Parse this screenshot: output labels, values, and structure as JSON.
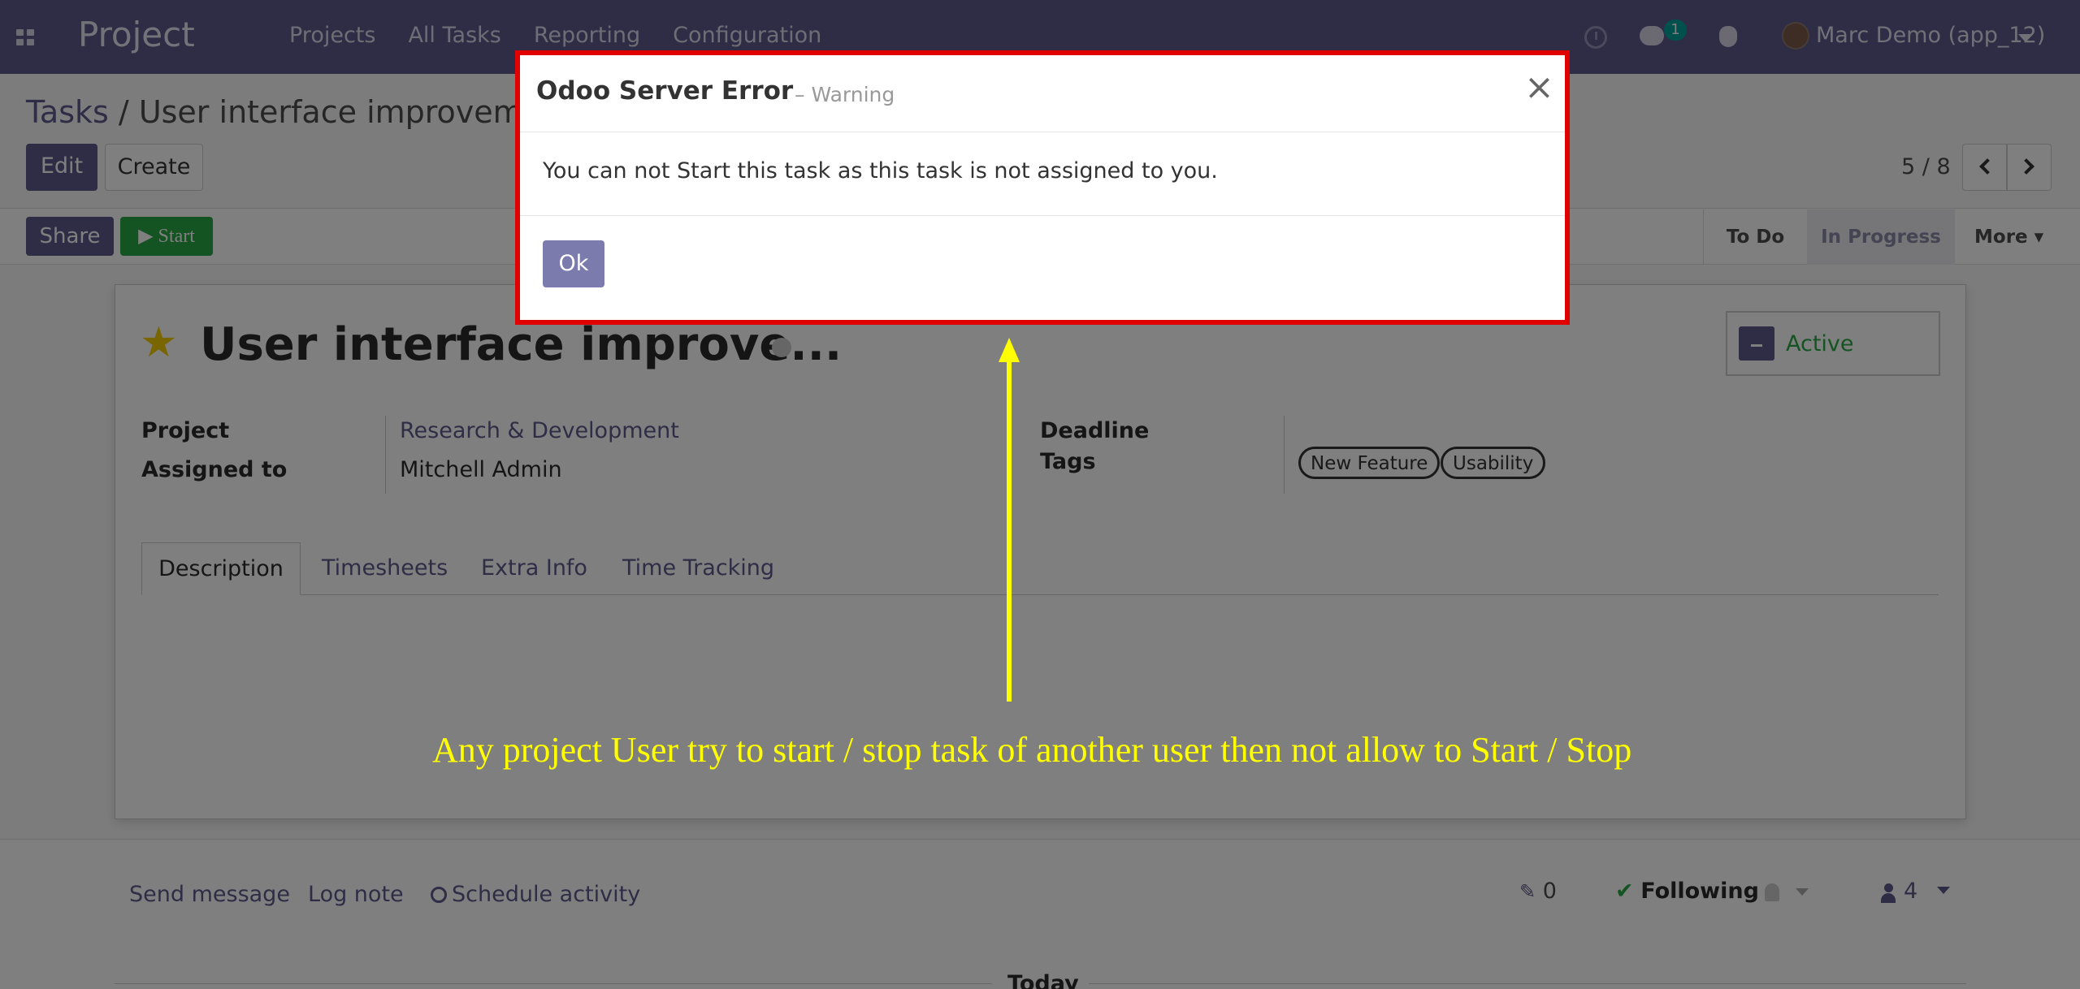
{
  "navbar": {
    "brand": "Project",
    "menu": [
      "Projects",
      "All Tasks",
      "Reporting",
      "Configuration"
    ],
    "chat_badge": "1",
    "user_name": "Marc Demo (app_12)"
  },
  "breadcrumb": {
    "parent": "Tasks",
    "separator": "/",
    "current": "User interface improvemer"
  },
  "toolbar": {
    "edit_label": "Edit",
    "create_label": "Create",
    "pager": "5 / 8"
  },
  "statusbar": {
    "share_label": "Share",
    "start_label": "▶ Start",
    "stages": [
      "To Do",
      "In Progress"
    ],
    "more_label": "More ▾"
  },
  "form": {
    "title": "User interface improve...",
    "active_label": "Active",
    "fields": {
      "project_label": "Project",
      "project_value": "Research & Development",
      "assigned_label": "Assigned to",
      "assigned_value": "Mitchell Admin",
      "deadline_label": "Deadline",
      "tags_label": "Tags",
      "tags": [
        "New Feature",
        "Usability"
      ]
    },
    "tabs": [
      "Description",
      "Timesheets",
      "Extra Info",
      "Time Tracking"
    ]
  },
  "chatter": {
    "send_message": "Send message",
    "log_note": "Log note",
    "schedule_activity": "Schedule activity",
    "attachments_count": "0",
    "following_label": "Following",
    "followers_count": "4",
    "today_label": "Today"
  },
  "modal": {
    "title": "Odoo Server Error",
    "subtitle": "– Warning",
    "close_glyph": "×",
    "message": "You can not Start this task as this task is not assigned to you.",
    "ok_label": "Ok"
  },
  "annotation": {
    "text": "Any project User try to start / stop task of another user then not allow to Start / Stop"
  },
  "colors": {
    "brand": "#5e5a8c",
    "start_green": "#28a745",
    "modal_border": "#e00000",
    "annotation": "#ffff00",
    "star": "#f3cc00"
  }
}
